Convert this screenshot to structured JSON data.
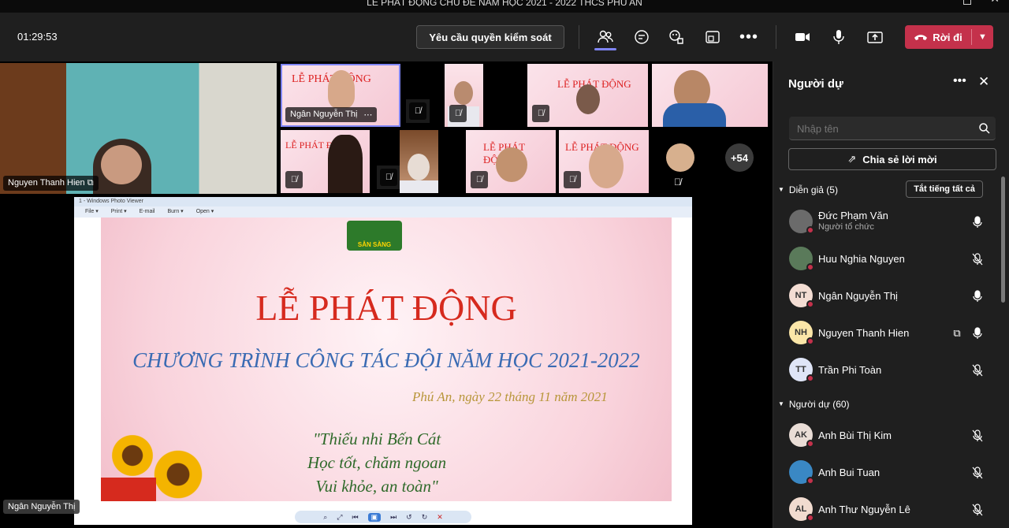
{
  "window": {
    "title": "LỄ PHÁT ĐỘNG CHỦ ĐỀ NĂM HỌC 2021 - 2022 THCS PHÚ AN"
  },
  "toolbar": {
    "timer": "01:29:53",
    "request_control": "Yêu cầu quyền kiểm soát",
    "leave": "Rời đi",
    "leave_color": "#c4314b"
  },
  "stage": {
    "main_speaker": "Nguyen Thanh Hien",
    "pinned_speaker": "Ngân Nguyễn Thị",
    "pinned_more": "⋯",
    "overflow_count": "+54",
    "share_presenter": "Ngân Nguyễn Thị"
  },
  "slide": {
    "window_title": "1 - Windows Photo Viewer",
    "menu": [
      "File ▾",
      "Print ▾",
      "E-mail",
      "Burn ▾",
      "Open ▾"
    ],
    "badge": "SẴN SÀNG",
    "headline": "LỄ PHÁT ĐỘNG",
    "subheadline": "CHƯƠNG TRÌNH CÔNG TÁC ĐỘI NĂM HỌC 2021-2022",
    "dateline": "Phú An, ngày 22 tháng 11 năm 2021",
    "slogan": [
      "\"Thiếu nhi Bến Cát",
      "Học tốt, chăm ngoan",
      "Vui khỏe, an toàn\""
    ]
  },
  "panel": {
    "title": "Người dự",
    "search_placeholder": "Nhập tên",
    "share_invite": "Chia sẻ lời mời",
    "presenters_header": "Diễn giả (5)",
    "mute_all": "Tắt tiếng tất cả",
    "attendees_header": "Người dự (60)",
    "presenters": [
      {
        "name": "Đức Phạm Văn",
        "sub": "Người tổ chức",
        "initials": "",
        "avatar_color": "#6b6b6b",
        "mic": "on"
      },
      {
        "name": "Huu Nghia Nguyen",
        "sub": "",
        "initials": "",
        "avatar_color": "#5a7a5a",
        "mic": "off"
      },
      {
        "name": "Ngân Nguyễn Thị",
        "sub": "",
        "initials": "NT",
        "avatar_color": "#f3ddd3",
        "mic": "on"
      },
      {
        "name": "Nguyen Thanh Hien",
        "sub": "",
        "initials": "NH",
        "avatar_color": "#fbe6a8",
        "mic": "on"
      },
      {
        "name": "Trần Phi Toàn",
        "sub": "",
        "initials": "TT",
        "avatar_color": "#dfe5f7",
        "mic": "off"
      }
    ],
    "attendees": [
      {
        "name": "Anh Bùi Thị Kim",
        "initials": "AK",
        "avatar_color": "#e9ddd6",
        "mic": "off"
      },
      {
        "name": "Anh Bui Tuan",
        "initials": "",
        "avatar_color": "#3a88c4",
        "mic": "off"
      },
      {
        "name": "Anh Thư Nguyễn Lê",
        "initials": "AL",
        "avatar_color": "#f1dbcf",
        "mic": "off"
      }
    ]
  }
}
